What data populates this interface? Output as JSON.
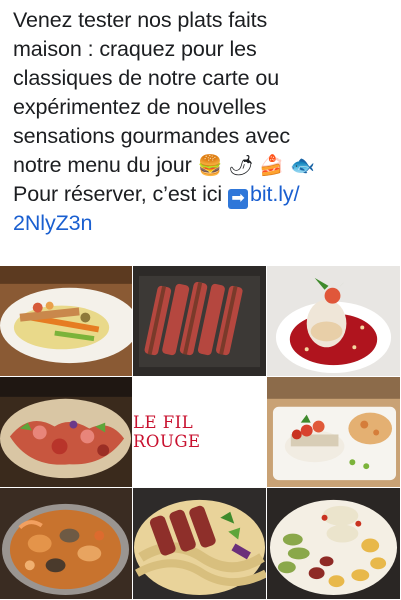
{
  "post": {
    "lines": [
      "Venez tester nos plats faits",
      "maison : craquez pour les",
      "classiques de notre carte ou",
      "expérimentez de nouvelles",
      "sensations gourmandes avec",
      "notre menu du jour"
    ],
    "emojis": [
      "🍔",
      "🌶",
      "🍰",
      "🐟"
    ],
    "reserve_text": "Pour réserver, c’est ici",
    "arrow_icon": "➡",
    "link_part1": "bit.ly/",
    "link_part2": "2NlyZ3n"
  },
  "gallery": {
    "brand_label": "LE FIL ROUGE",
    "images": [
      "skewers-on-plate",
      "sliced-duck-breast",
      "dessert-with-red-coulis",
      "charcuterie-platter",
      "brand-logo",
      "fish-with-tomato-salad",
      "seafood-soup-pot",
      "steak-with-pasta",
      "vegetable-and-potato-plate"
    ]
  },
  "colors": {
    "text": "#1c1e21",
    "link": "#1a5fd0",
    "brand": "#c8102e"
  }
}
